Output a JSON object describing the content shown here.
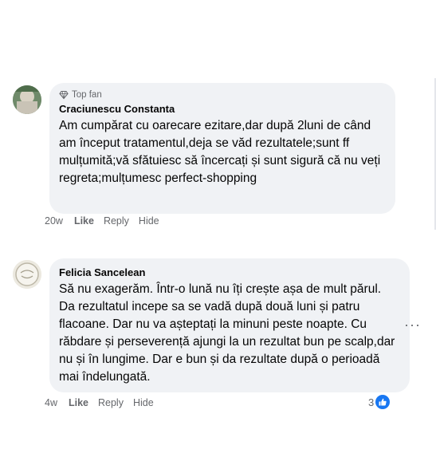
{
  "comments": [
    {
      "badge": "Top fan",
      "author": "Craciunescu Constanta",
      "text": "Am cumpărat cu oarecare ezitare,dar după 2luni de când am început tratamentul,deja se văd rezultatele;sunt ff mulțumită;vă sfătuiesc să încercați și sunt sigură că nu veți regreta;mulțumesc perfect-shopping",
      "time": "20w",
      "like_label": "Like",
      "reply_label": "Reply",
      "hide_label": "Hide"
    },
    {
      "author": "Felicia Sancelean",
      "text": "Să nu exagerăm. Într-o lună nu îți crește așa de mult părul. Da rezultatul incepe sa se vadă după două luni și patru flacoane. Dar nu va așteptați la minuni peste noapte. Cu răbdare și perseverență ajungi la un rezultat bun pe scalp,dar nu și în lungime. Dar e bun și da rezultate după o perioadă mai îndelungată.",
      "time": "4w",
      "like_label": "Like",
      "reply_label": "Reply",
      "hide_label": "Hide",
      "reaction_count": "3"
    }
  ],
  "more_label": "···",
  "icons": {
    "badge": "diamond-badge-icon",
    "reaction": "thumbs-up-icon",
    "more": "more-options-icon"
  },
  "colors": {
    "bubble": "#f0f2f5",
    "like_blue": "#1877f2",
    "secondary_text": "#65676b"
  }
}
